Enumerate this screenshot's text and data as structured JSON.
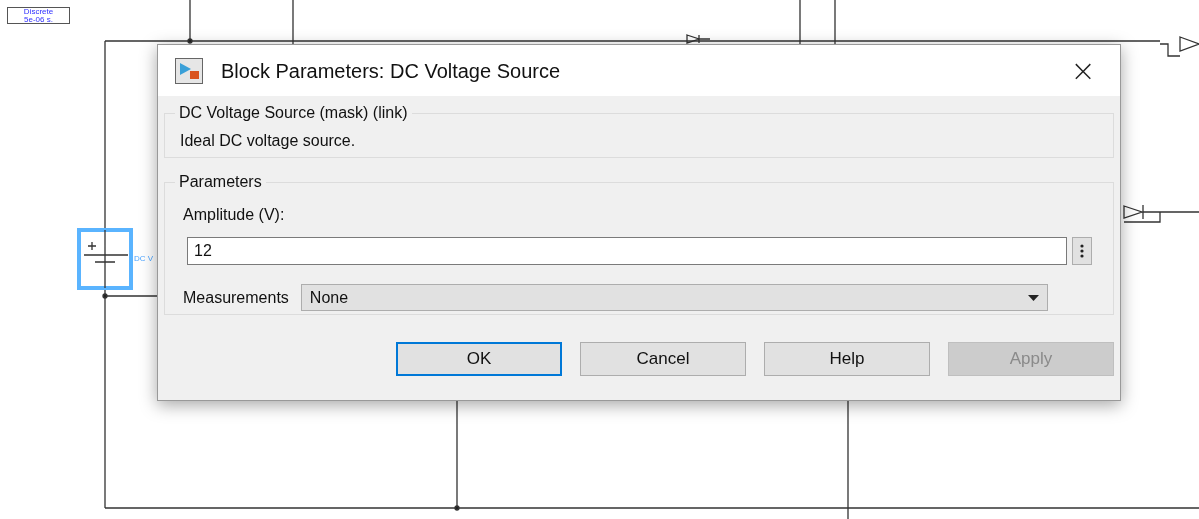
{
  "canvas": {
    "solver_block": [
      "Discrete",
      "5e-06 s."
    ],
    "source_label": "DC V"
  },
  "dialog": {
    "title": "Block Parameters: DC Voltage Source",
    "close": "×",
    "description_group": {
      "legend": "DC Voltage Source (mask) (link)",
      "text": "Ideal DC voltage source."
    },
    "parameters_group": {
      "legend": "Parameters",
      "amplitude_label": "Amplitude (V):",
      "amplitude_value": "12",
      "measurements_label": "Measurements",
      "measurements_value": "None"
    },
    "buttons": [
      {
        "label": "OK",
        "default": true,
        "disabled": false
      },
      {
        "label": "Cancel",
        "default": false,
        "disabled": false
      },
      {
        "label": "Help",
        "default": false,
        "disabled": false
      },
      {
        "label": "Apply",
        "default": false,
        "disabled": true
      }
    ]
  }
}
